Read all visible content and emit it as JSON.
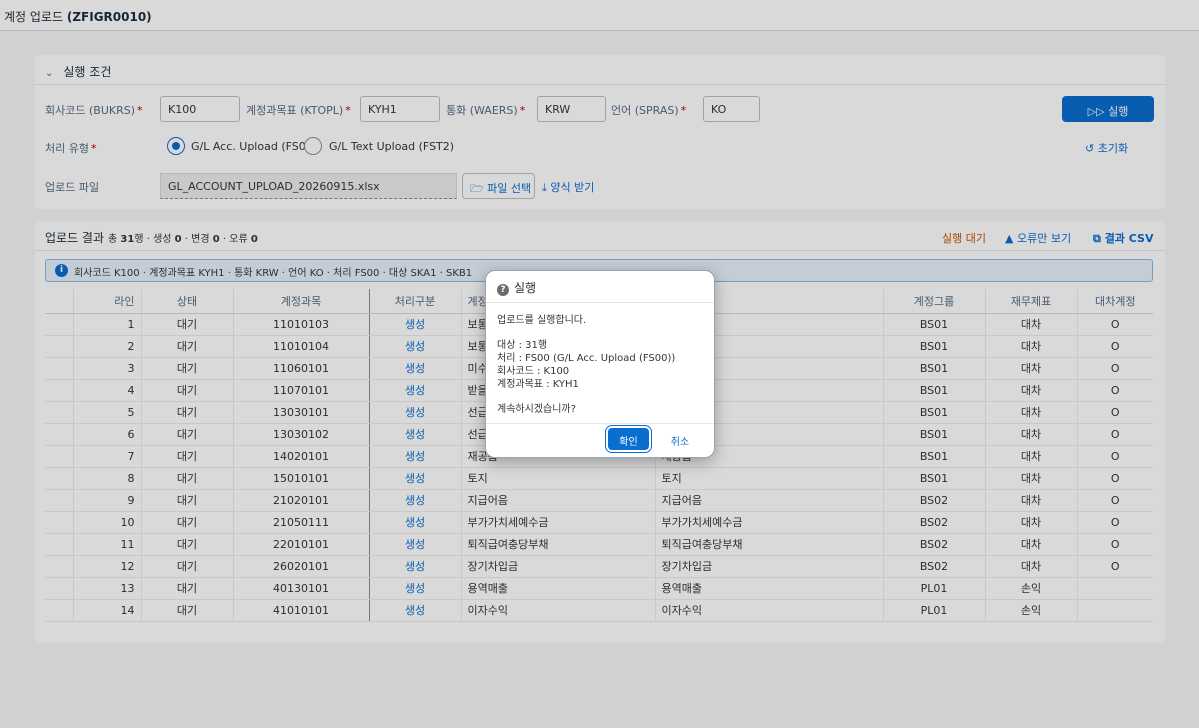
{
  "app": {
    "title_prefix": "계정 업로드 ",
    "title_code": "(ZFIGR0010)"
  },
  "criteria": {
    "section_title": "실행 조건",
    "company_label": "회사코드 (BUKRS)",
    "company_value": "K100",
    "coa_label": "계정과목표 (KTOPL)",
    "coa_value": "KYH1",
    "currency_label": "통화 (WAERS)",
    "currency_value": "KRW",
    "language_label": "언어 (SPRAS)",
    "language_value": "KO",
    "required_mark": "*",
    "run_label": "실행",
    "process_label": "처리 유형",
    "radio1_label": "G/L Acc. Upload (FS00)",
    "radio2_label": "G/L Text Upload (FST2)",
    "reset_label": "초기화",
    "file_label": "업로드 파일",
    "file_value": "GL_ACCOUNT_UPLOAD_20260915.xlsx",
    "file_select_label": "파일 선택",
    "template_label": "양식 받기"
  },
  "results": {
    "title": "업로드 결과",
    "summary_prefix": "총 ",
    "total": "31",
    "summary_mid1": "행 · 생성 ",
    "created": "0",
    "summary_mid2": " · 변경 ",
    "changed": "0",
    "summary_mid3": " · 오류 ",
    "errors": "0",
    "status": "실행 대기",
    "errors_only_label": "오류만 보기",
    "csv_label": "결과 CSV",
    "info": "회사코드 K100 · 계정과목표 KYH1 · 통화 KRW · 언어 KO · 처리 FS00 · 대상 SKA1 · SKB1",
    "columns": [
      "라인",
      "상태",
      "계정과목",
      "처리구분",
      "계정",
      "",
      "계정그룹",
      "재무제표",
      "대차계정"
    ],
    "rows": [
      {
        "line": "1",
        "status": "대기",
        "account": "11010103",
        "proc": "생성",
        "name": "보통",
        "long": "나",
        "group": "BS01",
        "fs": "대차",
        "flag": "O"
      },
      {
        "line": "2",
        "status": "대기",
        "account": "11010104",
        "proc": "생성",
        "name": "보통",
        "long": "리",
        "group": "BS01",
        "fs": "대차",
        "flag": "O"
      },
      {
        "line": "3",
        "status": "대기",
        "account": "11060101",
        "proc": "생성",
        "name": "미수",
        "long": "",
        "group": "BS01",
        "fs": "대차",
        "flag": "O"
      },
      {
        "line": "4",
        "status": "대기",
        "account": "11070101",
        "proc": "생성",
        "name": "받을",
        "long": "",
        "group": "BS01",
        "fs": "대차",
        "flag": "O"
      },
      {
        "line": "5",
        "status": "대기",
        "account": "13030101",
        "proc": "생성",
        "name": "선급",
        "long": "",
        "group": "BS01",
        "fs": "대차",
        "flag": "O"
      },
      {
        "line": "6",
        "status": "대기",
        "account": "13030102",
        "proc": "생성",
        "name": "선급",
        "long": "",
        "group": "BS01",
        "fs": "대차",
        "flag": "O"
      },
      {
        "line": "7",
        "status": "대기",
        "account": "14020101",
        "proc": "생성",
        "name": "재공품",
        "long": "재공품",
        "group": "BS01",
        "fs": "대차",
        "flag": "O"
      },
      {
        "line": "8",
        "status": "대기",
        "account": "15010101",
        "proc": "생성",
        "name": "토지",
        "long": "토지",
        "group": "BS01",
        "fs": "대차",
        "flag": "O"
      },
      {
        "line": "9",
        "status": "대기",
        "account": "21020101",
        "proc": "생성",
        "name": "지급어음",
        "long": "지급어음",
        "group": "BS02",
        "fs": "대차",
        "flag": "O"
      },
      {
        "line": "10",
        "status": "대기",
        "account": "21050111",
        "proc": "생성",
        "name": "부가가치세예수금",
        "long": "부가가치세예수금",
        "group": "BS02",
        "fs": "대차",
        "flag": "O"
      },
      {
        "line": "11",
        "status": "대기",
        "account": "22010101",
        "proc": "생성",
        "name": "퇴직급여충당부채",
        "long": "퇴직급여충당부채",
        "group": "BS02",
        "fs": "대차",
        "flag": "O"
      },
      {
        "line": "12",
        "status": "대기",
        "account": "26020101",
        "proc": "생성",
        "name": "장기차입금",
        "long": "장기차입금",
        "group": "BS02",
        "fs": "대차",
        "flag": "O"
      },
      {
        "line": "13",
        "status": "대기",
        "account": "40130101",
        "proc": "생성",
        "name": "용역매출",
        "long": "용역매출",
        "group": "PL01",
        "fs": "손익",
        "flag": ""
      },
      {
        "line": "14",
        "status": "대기",
        "account": "41010101",
        "proc": "생성",
        "name": "이자수익",
        "long": "이자수익",
        "group": "PL01",
        "fs": "손익",
        "flag": ""
      }
    ]
  },
  "dialog": {
    "title": "실행",
    "line1": "업로드를 실행합니다.",
    "target": "대상 : 31행",
    "process": "처리 : FS00 (G/L Acc. Upload (FS00))",
    "company": "회사코드 : K100",
    "coa": "계정과목표 : KYH1",
    "confirm_q": "계속하시겠습니까?",
    "ok_label": "확인",
    "cancel_label": "취소"
  }
}
